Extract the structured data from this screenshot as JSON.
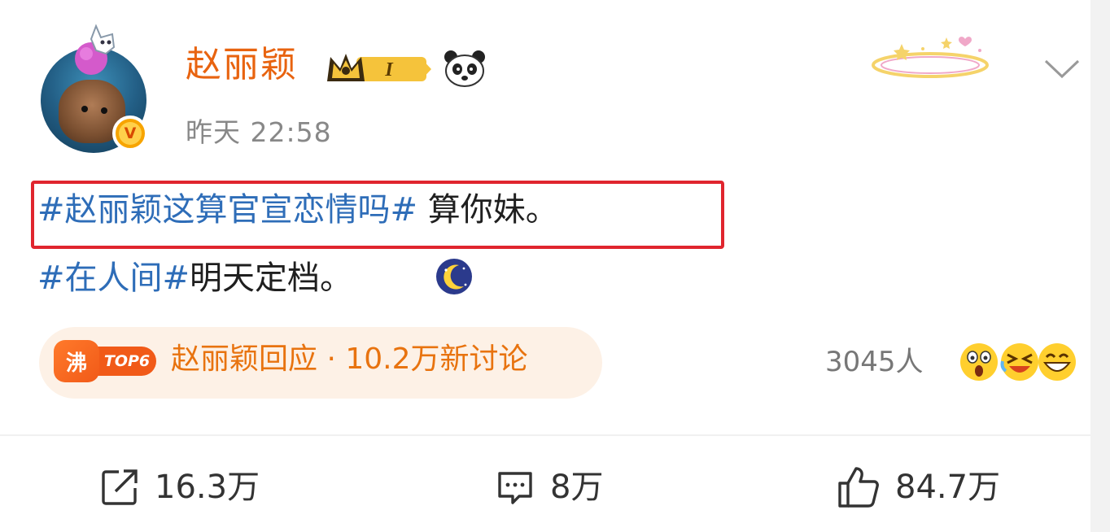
{
  "post": {
    "author": "赵丽颖",
    "verified_badge": "V",
    "member_level": "I",
    "time": "昨天 22:58",
    "line1": {
      "topic": "#赵丽颖这算官宣恋情吗#",
      "text": " 算你妹。"
    },
    "line2": {
      "topic": "#在人间#",
      "text": "明天定档。"
    }
  },
  "hot": {
    "fei_label": "沸",
    "rank_label": "TOP6",
    "text": "赵丽颖回应 · 10.2万新讨论"
  },
  "reactions": {
    "people": "3045人",
    "emojis": [
      "shocked-face-icon",
      "laughing-crying-face-icon",
      "grinning-face-icon"
    ]
  },
  "actions": {
    "repost": "16.3万",
    "comment": "8万",
    "like": "84.7万"
  },
  "colors": {
    "username": "#e8630f",
    "topic": "#2e6db8",
    "highlight_border": "#e0252e",
    "hot_text": "#e8730f"
  }
}
